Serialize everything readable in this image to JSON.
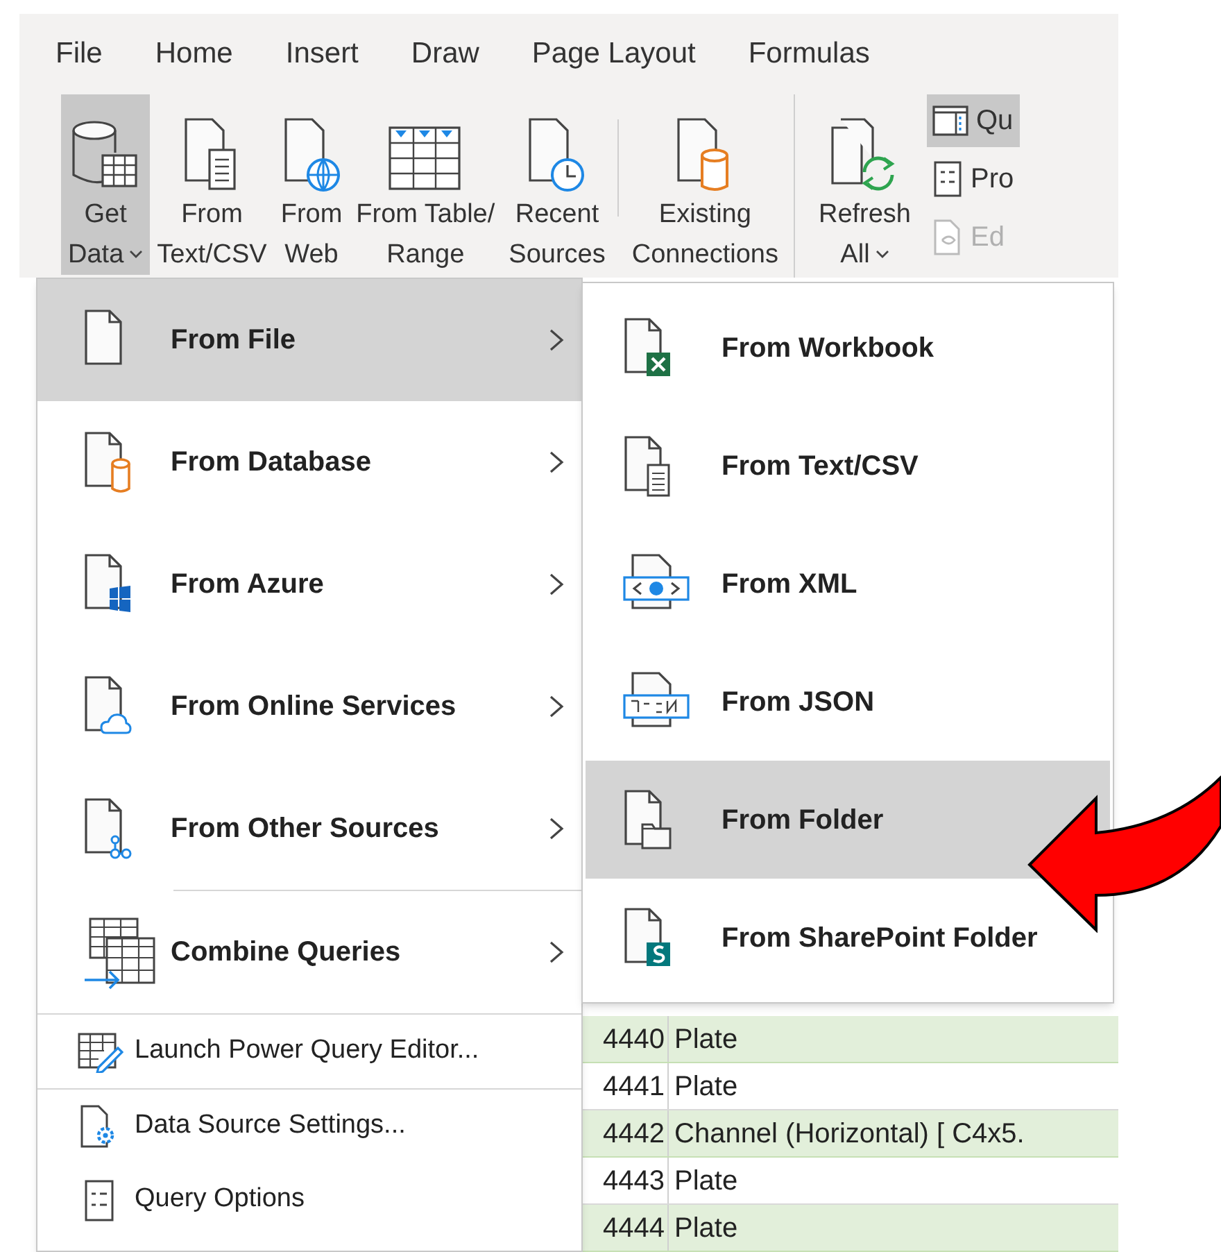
{
  "ribbon": {
    "tabs": [
      {
        "label": "File"
      },
      {
        "label": "Home"
      },
      {
        "label": "Insert"
      },
      {
        "label": "Draw"
      },
      {
        "label": "Page Layout"
      },
      {
        "label": "Formulas"
      }
    ],
    "groups": [
      {
        "buttons": [
          {
            "lines": [
              "Get",
              "Data"
            ],
            "dropdown": true,
            "selected": true,
            "divider_before": false
          },
          {
            "lines": [
              "From",
              "Text/CSV"
            ],
            "dropdown": false,
            "selected": false,
            "divider_before": false
          },
          {
            "lines": [
              "From",
              "Web"
            ],
            "dropdown": false,
            "selected": false,
            "divider_before": false
          },
          {
            "lines": [
              "From Table/",
              "Range"
            ],
            "dropdown": false,
            "selected": false,
            "divider_before": false
          },
          {
            "lines": [
              "Recent",
              "Sources"
            ],
            "dropdown": false,
            "selected": false,
            "divider_before": false
          },
          {
            "lines": [
              "Existing",
              "Connections"
            ],
            "dropdown": false,
            "selected": false,
            "divider_before": true
          }
        ]
      },
      {
        "buttons": [
          {
            "lines": [
              "Refresh",
              "All"
            ],
            "dropdown": true,
            "selected": false,
            "divider_before": false
          }
        ],
        "small_buttons": [
          {
            "label": "Qu",
            "selected": true,
            "disabled": false
          },
          {
            "label": "Pro",
            "selected": false,
            "disabled": false
          },
          {
            "label": "Ed",
            "selected": false,
            "disabled": true
          }
        ]
      }
    ]
  },
  "sheet": {
    "rows": [
      {
        "id": "4440",
        "item": "Plate",
        "shaded": true
      },
      {
        "id": "4441",
        "item": "Plate",
        "shaded": false
      },
      {
        "id": "4442",
        "item": "Channel (Horizontal) [ C4x5.",
        "shaded": true
      },
      {
        "id": "4443",
        "item": "Plate",
        "shaded": false
      },
      {
        "id": "4444",
        "item": "Plate",
        "shaded": true
      }
    ]
  },
  "get_data_menu": {
    "items": [
      {
        "kind": "source",
        "label": "From File",
        "selected": true,
        "separator_before": false
      },
      {
        "kind": "source",
        "label": "From Database",
        "selected": false,
        "separator_before": false
      },
      {
        "kind": "source",
        "label": "From Azure",
        "selected": false,
        "separator_before": false
      },
      {
        "kind": "source",
        "label": "From Online Services",
        "selected": false,
        "separator_before": false
      },
      {
        "kind": "source",
        "label": "From Other Sources",
        "selected": false,
        "separator_before": false
      },
      {
        "kind": "source",
        "label": "Combine Queries",
        "selected": false,
        "separator_before": true
      },
      {
        "kind": "command",
        "label": "Launch Power Query Editor...",
        "selected": false,
        "separator_before": true
      },
      {
        "kind": "command",
        "label": "Data Source Settings...",
        "selected": false,
        "separator_before": true
      },
      {
        "kind": "command",
        "label": "Query Options",
        "selected": false,
        "separator_before": false
      }
    ]
  },
  "from_file_submenu": {
    "items": [
      {
        "label": "From Workbook",
        "selected": false
      },
      {
        "label": "From Text/CSV",
        "selected": false
      },
      {
        "label": "From XML",
        "selected": false
      },
      {
        "label": "From JSON",
        "selected": false
      },
      {
        "label": "From Folder",
        "selected": true
      },
      {
        "label": "From SharePoint Folder",
        "selected": false
      }
    ]
  }
}
